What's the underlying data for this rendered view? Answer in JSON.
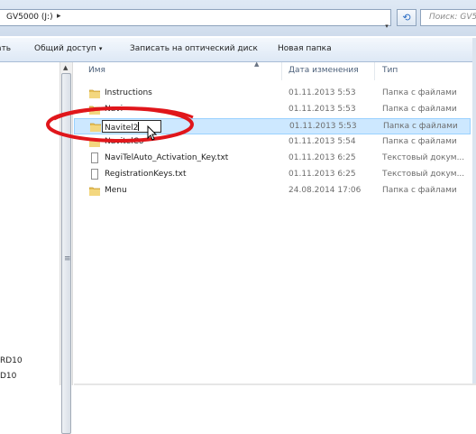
{
  "address_bar": {
    "path": "GV5000 (J:)",
    "chevron": "▸",
    "dropdown": "▾",
    "refresh_icon": "refresh-icon",
    "search_placeholder": "Поиск: GV5"
  },
  "toolbar": {
    "items": [
      {
        "label": "ать"
      },
      {
        "label": "Общий доступ",
        "arrow": "▾"
      },
      {
        "label": "Записать на оптический диск"
      },
      {
        "label": "Новая папка"
      }
    ]
  },
  "nav_pane": {
    "items": [
      "RD10",
      "D10"
    ]
  },
  "columns": {
    "name": "Имя",
    "date": "Дата изменения",
    "type": "Тип"
  },
  "files": [
    {
      "name": "Instructions",
      "date": "01.11.2013 5:53",
      "type": "Папка с файлами",
      "icon": "folder-icon"
    },
    {
      "name": "Navi",
      "date": "01.11.2013 5:53",
      "type": "Папка с файлами",
      "icon": "folder-icon"
    },
    {
      "name": "Navitel2",
      "date": "01.11.2013 5:53",
      "type": "Папка с файлами",
      "icon": "folder-icon",
      "selected": true,
      "renaming": true
    },
    {
      "name": "NavitelCo",
      "date": "01.11.2013 5:54",
      "type": "Папка с файлами",
      "icon": "folder-icon"
    },
    {
      "name": "NaviTelAuto_Activation_Key.txt",
      "date": "01.11.2013 6:25",
      "type": "Текстовый докум...",
      "icon": "text-file-icon"
    },
    {
      "name": "RegistrationKeys.txt",
      "date": "01.11.2013 6:25",
      "type": "Текстовый докум...",
      "icon": "text-file-icon"
    },
    {
      "name": "Menu",
      "date": "24.08.2014 17:06",
      "type": "Папка с файлами",
      "icon": "folder-icon"
    }
  ],
  "colors": {
    "selection": "#cde8ff",
    "annotation": "#e0161b",
    "folder": "#e8c25a"
  }
}
